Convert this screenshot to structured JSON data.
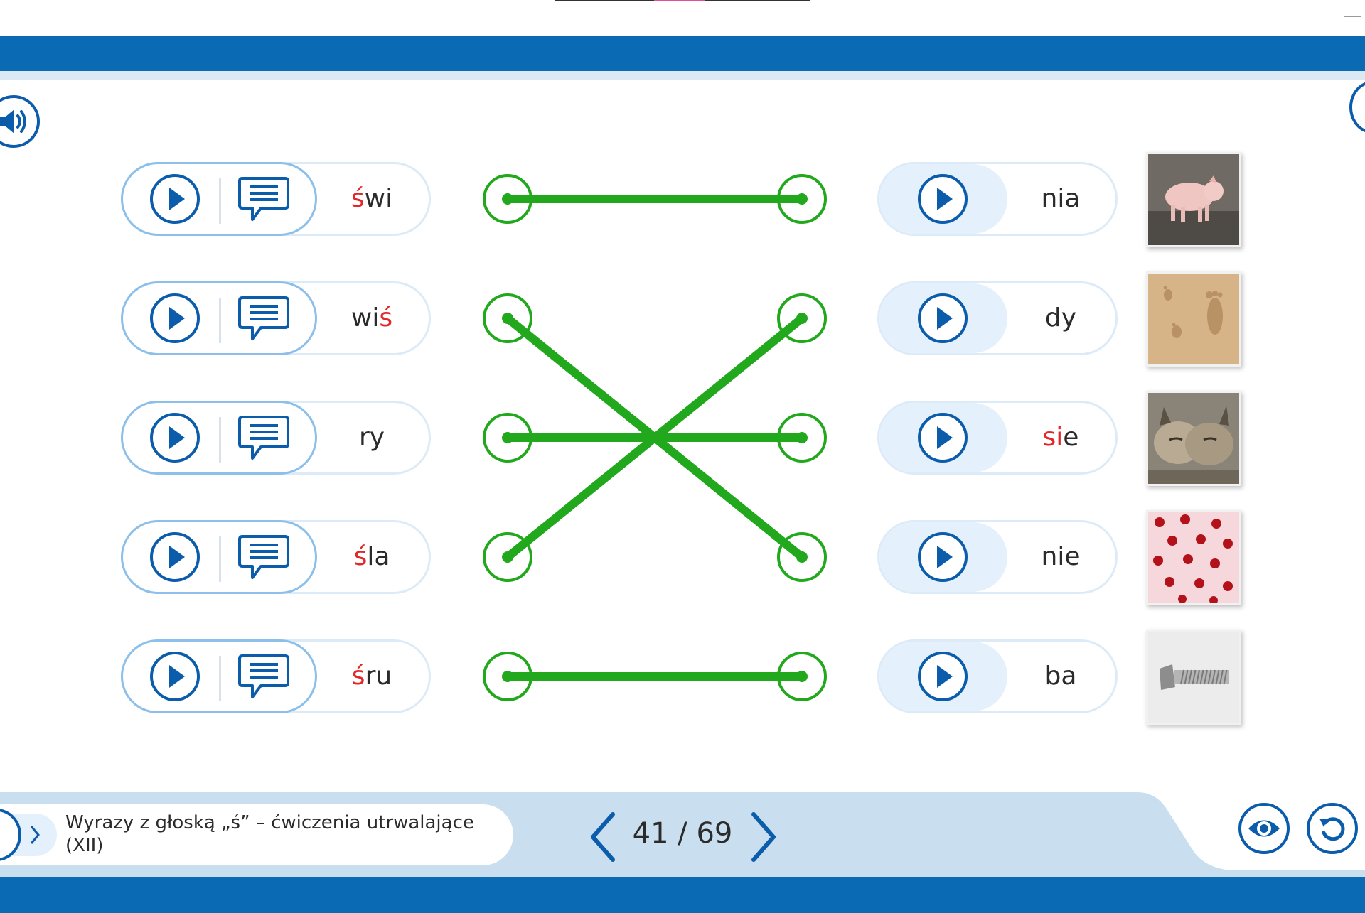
{
  "header": {
    "speaker_icon": "speaker-icon",
    "edge_icon": "menu-icon"
  },
  "left_items": [
    {
      "pre": "",
      "red": "ś",
      "post": "wi"
    },
    {
      "pre": "wi",
      "red": "ś",
      "post": ""
    },
    {
      "pre": "ry",
      "red": "",
      "post": ""
    },
    {
      "pre": "",
      "red": "ś",
      "post": "la"
    },
    {
      "pre": "",
      "red": "ś",
      "post": "ru"
    }
  ],
  "right_items": [
    {
      "pre": "nia",
      "red": "",
      "post": "",
      "picture": "pig"
    },
    {
      "pre": "dy",
      "red": "",
      "post": "",
      "picture": "footprints"
    },
    {
      "pre": "",
      "red": "si",
      "post": "e",
      "picture": "lynx"
    },
    {
      "pre": "nie",
      "red": "",
      "post": "",
      "picture": "cherries"
    },
    {
      "pre": "ba",
      "red": "",
      "post": "",
      "picture": "screw"
    }
  ],
  "connections": [
    [
      1,
      1
    ],
    [
      2,
      4
    ],
    [
      3,
      3
    ],
    [
      4,
      2
    ],
    [
      5,
      5
    ]
  ],
  "colors": {
    "primary": "#0b5cab",
    "bar": "#0a6ab4",
    "accent_red": "#e32629",
    "line_green": "#22a81c",
    "panel": "#c9deee"
  },
  "footer": {
    "lesson_title": "Wyrazy z głoską „ś” – ćwiczenia utrwalające (XII)",
    "page_counter": "41 / 69",
    "prev_icon": "chevron-left-icon",
    "next_icon": "chevron-right-icon",
    "eye_icon": "eye-icon",
    "reset_icon": "reset-icon"
  }
}
